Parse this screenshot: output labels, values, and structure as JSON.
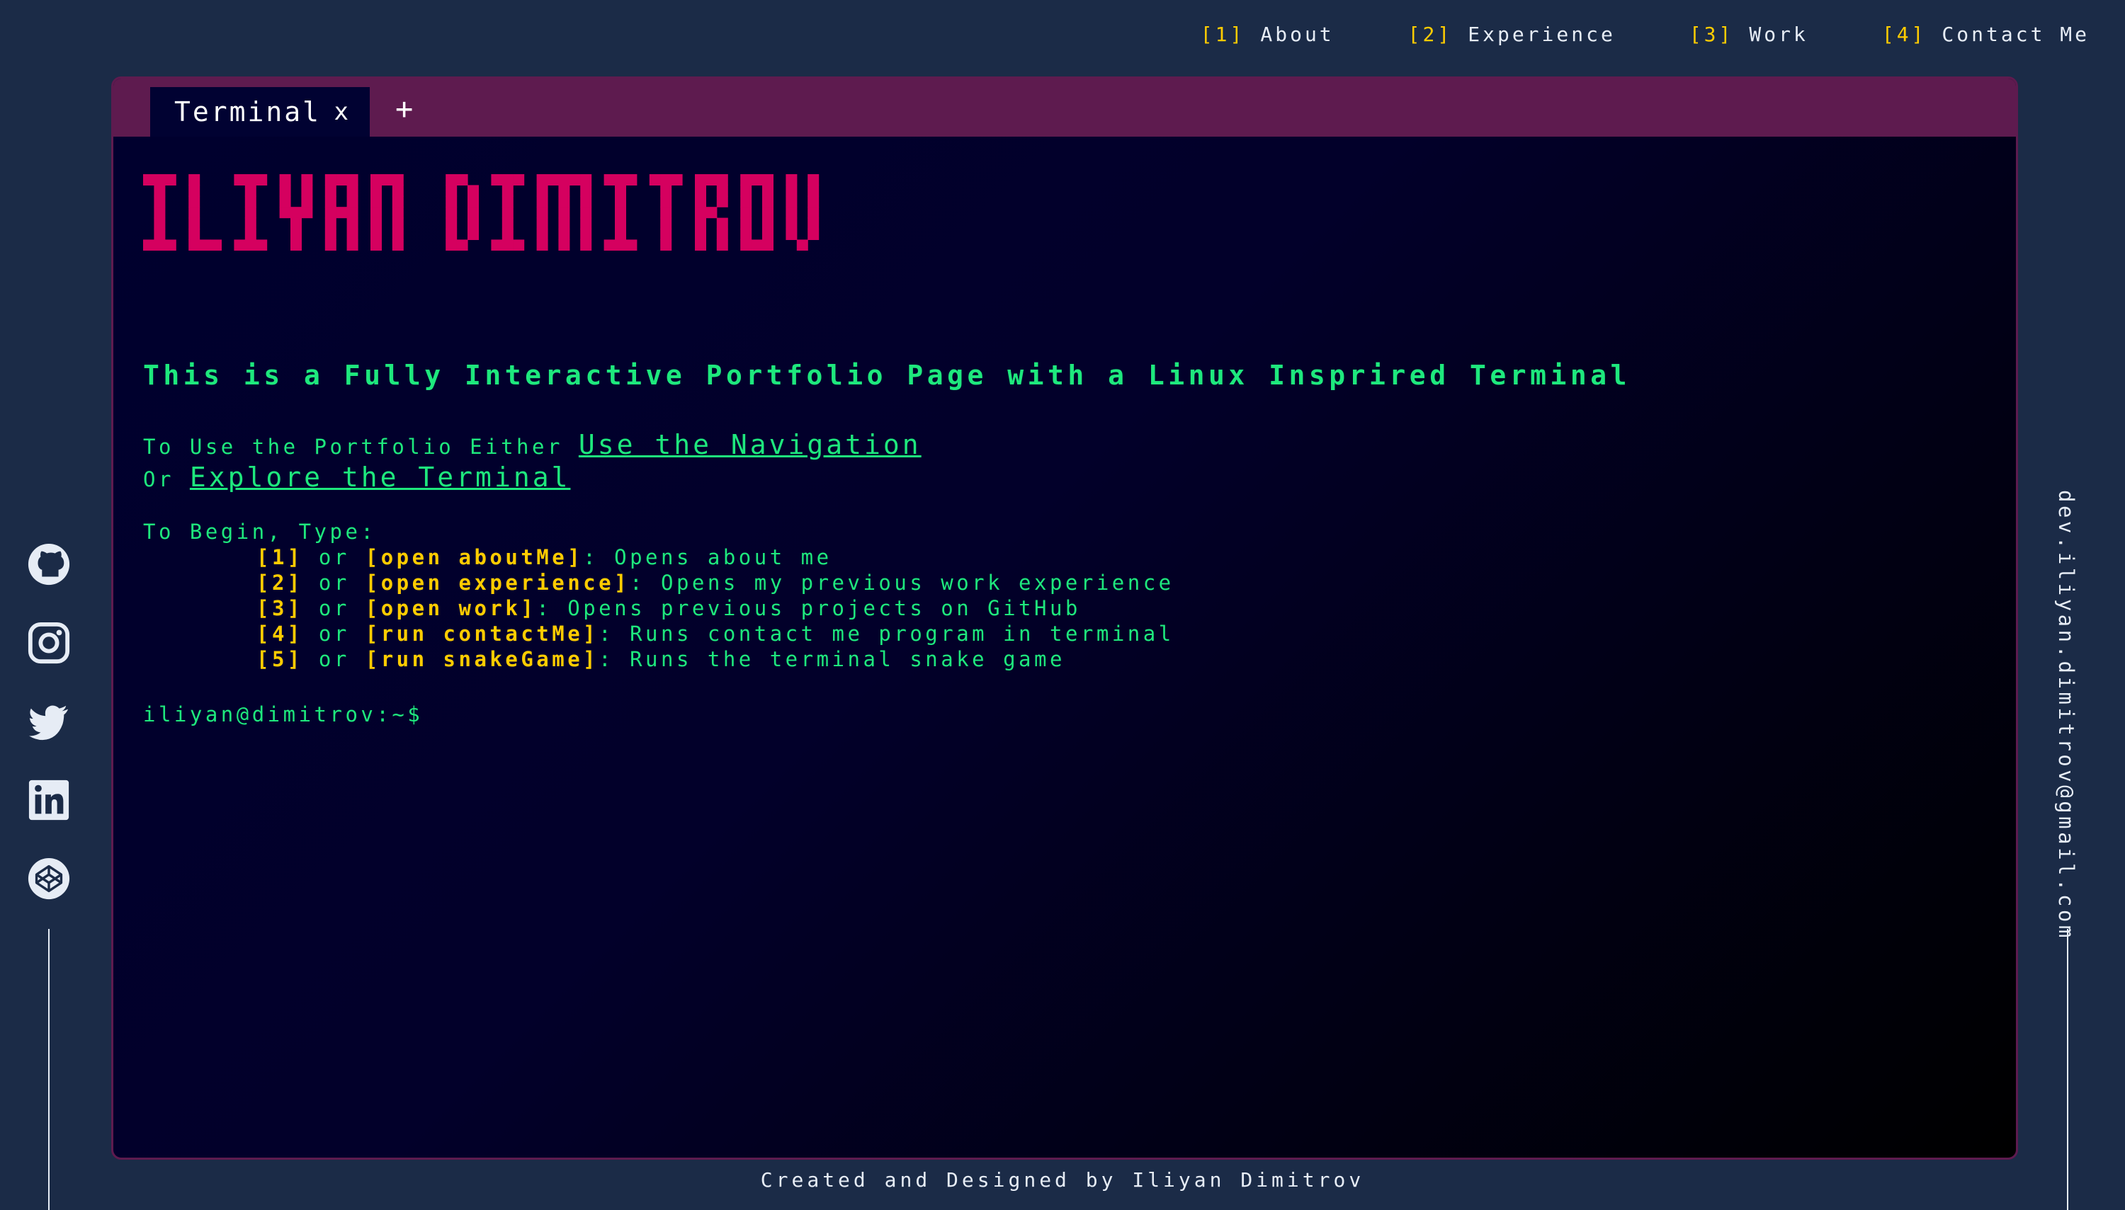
{
  "nav": [
    {
      "num": "[1]",
      "label": "About"
    },
    {
      "num": "[2]",
      "label": "Experience"
    },
    {
      "num": "[3]",
      "label": "Work"
    },
    {
      "num": "[4]",
      "label": "Contact Me"
    }
  ],
  "tab": {
    "title": "Terminal",
    "close": "x",
    "add": "+"
  },
  "hero": {
    "name": "ILIYAN DIMITROV"
  },
  "subtitle": "This is a Fully Interactive Portfolio Page with a Linux Insprired Terminal",
  "intro": {
    "line1_text": "To Use the Portfolio Either",
    "line1_link": "Use the Navigation",
    "line2_text": "Or",
    "line2_link": "Explore the Terminal"
  },
  "begin": "To Begin, Type:",
  "commands": [
    {
      "key": "[1]",
      "or": "or",
      "cmd": "[open aboutMe]",
      "desc": ": Opens about me"
    },
    {
      "key": "[2]",
      "or": "or",
      "cmd": "[open experience]",
      "desc": ": Opens my previous work experience"
    },
    {
      "key": "[3]",
      "or": "or",
      "cmd": "[open work]",
      "desc": ": Opens previous projects on GitHub"
    },
    {
      "key": "[4]",
      "or": "or",
      "cmd": "[run contactMe]",
      "desc": ": Runs contact me program in terminal"
    },
    {
      "key": "[5]",
      "or": "or",
      "cmd": "[run snakeGame]",
      "desc": ": Runs the terminal snake game"
    }
  ],
  "prompt": "iliyan@dimitrov:~$",
  "socials": [
    "github-icon",
    "instagram-icon",
    "twitter-icon",
    "linkedin-icon",
    "codepen-icon"
  ],
  "email": "dev.iliyan.dimitrov@gmail.com",
  "footer": "Created and Designed by Iliyan Dimitrov",
  "colors": {
    "background": "#1b2b47",
    "accent_yellow": "#ffcc00",
    "terminal_green": "#1ee87d",
    "title_pink": "#d5005f",
    "tabbar": "#5e1b4f"
  }
}
